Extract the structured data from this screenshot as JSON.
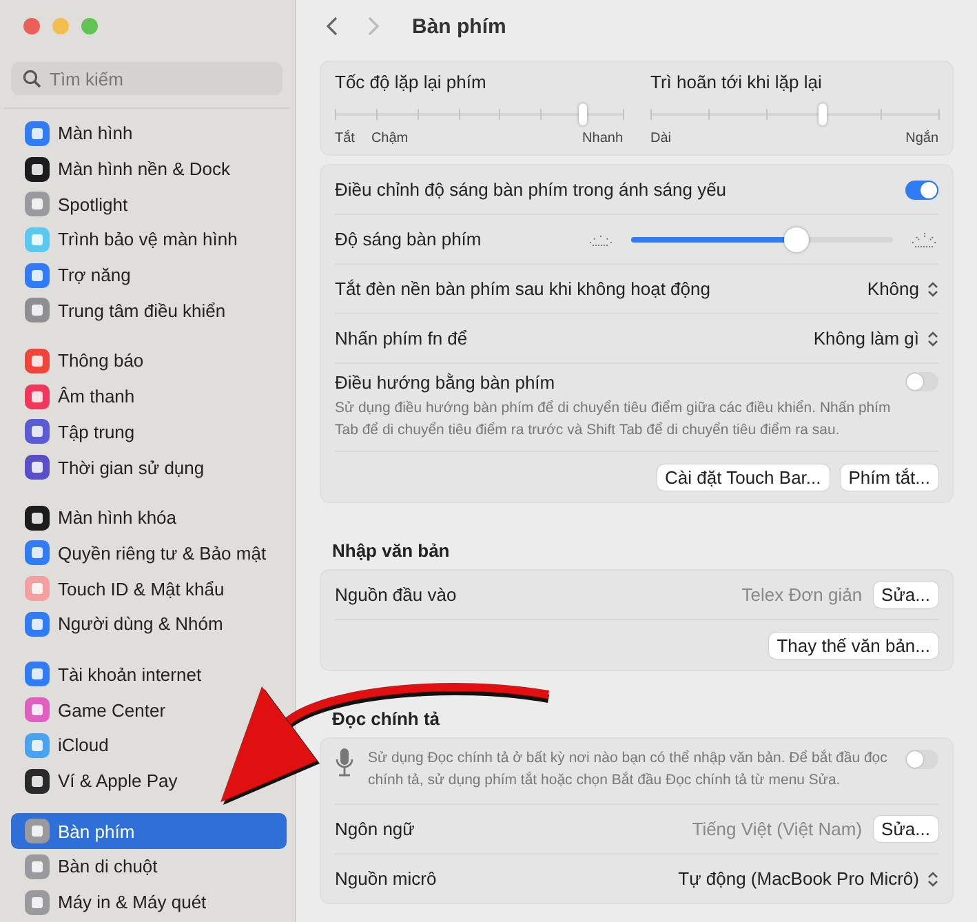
{
  "sidebar": {
    "search": {
      "placeholder": "Tìm kiếm"
    },
    "groups": [
      [
        {
          "label": "Màn hình",
          "color": "#2f7cf6",
          "selected": false
        },
        {
          "label": "Màn hình nền & Dock",
          "color": "#1c1c1e",
          "selected": false
        },
        {
          "label": "Spotlight",
          "color": "#9a9a9e",
          "selected": false
        },
        {
          "label": "Trình bảo vệ màn hình",
          "color": "#5ac8f0",
          "selected": false
        },
        {
          "label": "Trợ năng",
          "color": "#2f7cf6",
          "selected": false
        },
        {
          "label": "Trung tâm điều khiển",
          "color": "#8e8e93",
          "selected": false
        }
      ],
      [
        {
          "label": "Thông báo",
          "color": "#f0453a",
          "selected": false
        },
        {
          "label": "Âm thanh",
          "color": "#f0365a",
          "selected": false
        },
        {
          "label": "Tập trung",
          "color": "#5b5bd6",
          "selected": false
        },
        {
          "label": "Thời gian sử dụng",
          "color": "#5b4fc9",
          "selected": false
        }
      ],
      [
        {
          "label": "Màn hình khóa",
          "color": "#1c1c1e",
          "selected": false
        },
        {
          "label": "Quyền riêng tư & Bảo mật",
          "color": "#2f7cf6",
          "selected": false
        },
        {
          "label": "Touch ID & Mật khẩu",
          "color": "#f2a0a0",
          "selected": false
        },
        {
          "label": "Người dùng & Nhóm",
          "color": "#2f7cf6",
          "selected": false
        }
      ],
      [
        {
          "label": "Tài khoản internet",
          "color": "#2f7cf6",
          "selected": false
        },
        {
          "label": "Game Center",
          "color": "#e060c0",
          "selected": false
        },
        {
          "label": "iCloud",
          "color": "#4aa3f0",
          "selected": false
        },
        {
          "label": "Ví & Apple Pay",
          "color": "#2a2a2a",
          "selected": false
        }
      ],
      [
        {
          "label": "Bàn phím",
          "color": "#9a9a9e",
          "selected": true
        },
        {
          "label": "Bàn di chuột",
          "color": "#9a9a9e",
          "selected": false
        },
        {
          "label": "Máy in & Máy quét",
          "color": "#9a9a9e",
          "selected": false
        }
      ]
    ]
  },
  "main": {
    "title": "Bàn phím",
    "repeat_card": [
      {
        "label": "Tốc độ lặp lại phím",
        "level": 0.86,
        "scale": [
          "Tắt",
          "Chậm",
          "Nhanh"
        ]
      },
      {
        "label": "Trì hoãn tới khi lặp lại",
        "level": 0.6,
        "scale": [
          "Dài",
          "Ngắn"
        ]
      }
    ],
    "keyboard_card": [
      {
        "kind": "toggle",
        "label": "Điều chỉnh độ sáng bàn phím trong ánh sáng yếu",
        "on": true
      },
      {
        "kind": "slider",
        "label": "Độ sáng bàn phím",
        "level": 0.63
      },
      {
        "kind": "popup",
        "label": "Tắt đèn nền bàn phím sau khi không hoạt động",
        "value": "Không"
      },
      {
        "kind": "popup",
        "label": "Nhấn phím fn để",
        "value": "Không làm gì"
      },
      {
        "kind": "toggle",
        "label": "Điều hướng bằng bàn phím",
        "on": false,
        "description": "Sử dụng điều hướng bàn phím để di chuyển tiêu điểm giữa các điều khiển. Nhấn phím Tab để di chuyển tiêu điểm ra trước và Shift Tab để di chuyển tiêu điểm ra sau."
      },
      {
        "kind": "buttons",
        "buttons": [
          "Cài đặt Touch Bar...",
          "Phím tắt..."
        ]
      }
    ],
    "text_input": {
      "heading": "Nhập văn bản",
      "rows": [
        {
          "kind": "value_button",
          "label": "Nguồn đầu vào",
          "value": "Telex Đơn giản",
          "button": "Sửa..."
        },
        {
          "kind": "buttons",
          "buttons": [
            "Thay thế văn bản..."
          ]
        }
      ]
    },
    "dictation": {
      "heading": "Đọc chính tả",
      "rows": [
        {
          "kind": "mic_toggle",
          "description": "Sử dụng Đọc chính tả ở bất kỳ nơi nào bạn có thể nhập văn bản. Để bắt đầu đọc chính tả, sử dụng phím tắt hoặc chọn Bắt đầu Đọc chính tả từ menu Sửa.",
          "on": false
        },
        {
          "kind": "value_button",
          "label": "Ngôn ngữ",
          "value": "Tiếng Việt (Việt Nam)",
          "button": "Sửa..."
        },
        {
          "kind": "popup",
          "label": "Nguồn micrô",
          "value": "Tự động (MacBook Pro Micrô)"
        }
      ]
    }
  }
}
